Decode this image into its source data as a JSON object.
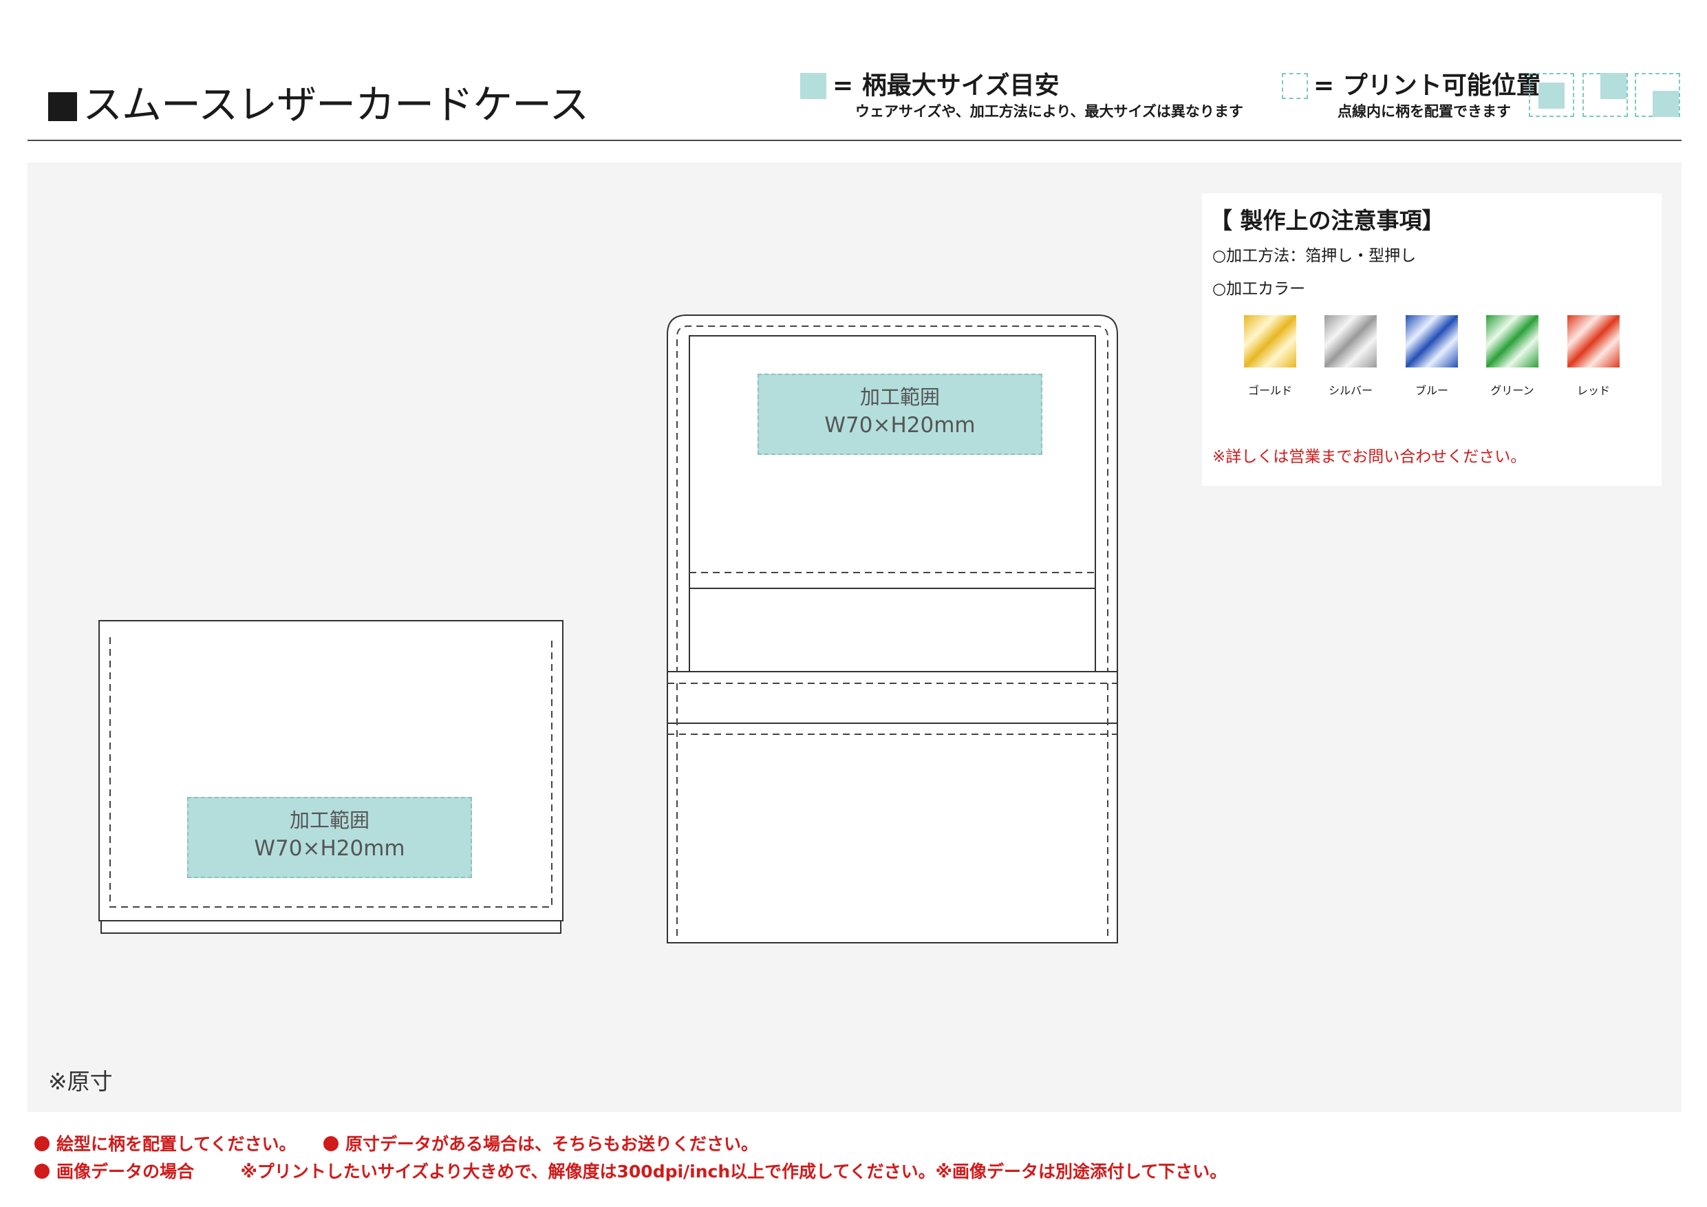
{
  "header": {
    "title": "スムースレザーカードケース",
    "legend_pattern_title": "= 柄最大サイズ目安",
    "legend_pattern_note": "ウェアサイズや、加工方法により、最大サイズは異なります",
    "legend_print_title": "= プリント可能位置",
    "legend_print_note": "点線内に柄を配置できます",
    "colors": {
      "print_area": "#b3dedc",
      "dashed": "#7cc9c6"
    }
  },
  "drawings": [
    {
      "label": "加工範囲",
      "size": "W70×H20mm"
    },
    {
      "label": "加工範囲",
      "size": "W70×H20mm"
    }
  ],
  "scale_note": "※原寸",
  "notes": {
    "title": "【 製作上の注意事項】",
    "method": "○加工方法：箔押し・型押し",
    "color_heading": "○加工カラー",
    "colors": [
      {
        "name": "ゴールド",
        "icon": "gold-foil-swatch",
        "hex": "#e8b722"
      },
      {
        "name": "シルバー",
        "icon": "silver-foil-swatch",
        "hex": "#9a9a9a"
      },
      {
        "name": "ブルー",
        "icon": "blue-foil-swatch",
        "hex": "#2350b5"
      },
      {
        "name": "グリーン",
        "icon": "green-foil-swatch",
        "hex": "#2ca13a"
      },
      {
        "name": "レッド",
        "icon": "red-foil-swatch",
        "hex": "#e03a1e"
      }
    ],
    "contact": "※詳しくは営業までお問い合わせください。"
  },
  "footer": {
    "line1a": "絵型に柄を配置してください。",
    "line1b": "原寸データがある場合は、そちらもお送りください。",
    "line2a": "画像データの場合",
    "line2b": "※プリントしたいサイズより大きめで、解像度は300dpi/inch以上で作成してください。※画像データは別途添付して下さい。"
  }
}
